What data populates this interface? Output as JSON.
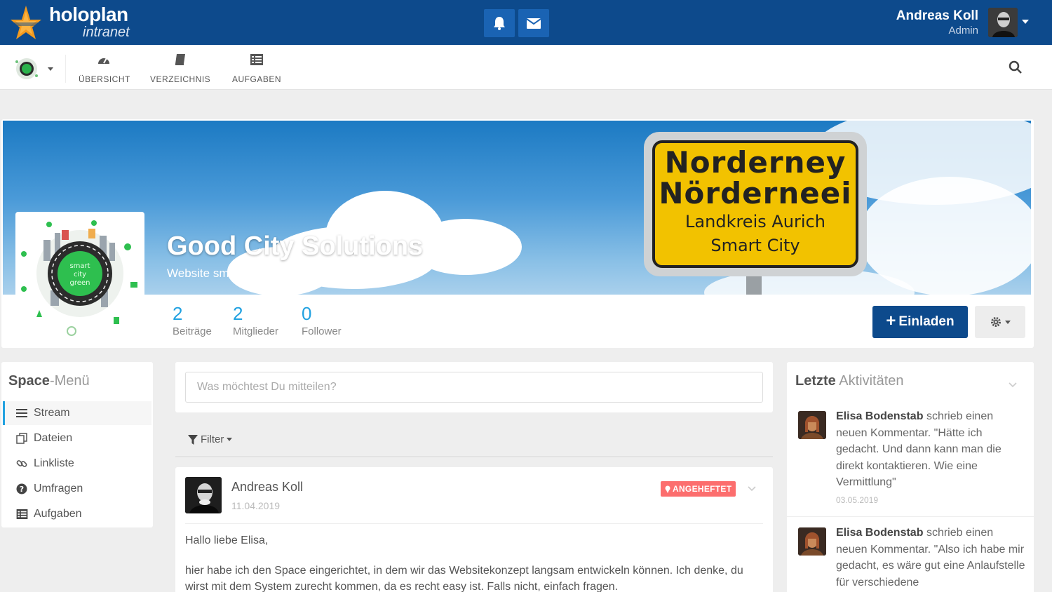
{
  "brand": {
    "name": "holoplan",
    "sub": "intranet"
  },
  "user": {
    "name": "Andreas Koll",
    "role": "Admin"
  },
  "nav": [
    {
      "label": "ÜBERSICHT",
      "icon": "dashboard-icon"
    },
    {
      "label": "VERZEICHNIS",
      "icon": "book-icon"
    },
    {
      "label": "AUFGABEN",
      "icon": "tasks-icon"
    }
  ],
  "space": {
    "title": "Good City Solutions",
    "description": "Website smartcity.green",
    "sign": {
      "line1": "Norderney",
      "line2": "Nörderneei",
      "line3": "Landkreis Aurich",
      "line4": "Smart City"
    },
    "logo_text": {
      "l1": "smart",
      "l2": "city",
      "l3": "green"
    }
  },
  "stats": [
    {
      "value": "2",
      "label": "Beiträge"
    },
    {
      "value": "2",
      "label": "Mitglieder"
    },
    {
      "value": "0",
      "label": "Follower"
    }
  ],
  "invite_label": "Einladen",
  "space_menu": {
    "title_bold": "Space",
    "title_rest": "-Menü",
    "items": [
      {
        "label": "Stream",
        "icon": "bars-icon",
        "active": true
      },
      {
        "label": "Dateien",
        "icon": "files-icon",
        "active": false
      },
      {
        "label": "Linkliste",
        "icon": "link-icon",
        "active": false
      },
      {
        "label": "Umfragen",
        "icon": "question-icon",
        "active": false
      },
      {
        "label": "Aufgaben",
        "icon": "tasks-icon",
        "active": false
      }
    ]
  },
  "post": {
    "placeholder": "Was möchtest Du mitteilen?"
  },
  "filter_label": "Filter",
  "entry": {
    "author": "Andreas Koll",
    "date": "11.04.2019",
    "pinned_label": "ANGEHEFTET",
    "greeting": "Hallo liebe Elisa,",
    "body": "hier habe ich den Space eingerichtet, in dem wir das Websitekonzept langsam entwickeln können. Ich denke, du wirst mit dem System zurecht kommen, da es recht easy ist. Falls nicht, einfach fragen."
  },
  "activities": {
    "title_bold": "Letzte",
    "title_rest": "Aktivitäten",
    "items": [
      {
        "user": "Elisa Bodenstab",
        "text": "schrieb einen neuen Kommentar. \"Hätte ich gedacht. Und dann kann man die direkt kontaktieren. Wie eine Vermittlung\"",
        "date": "03.05.2019"
      },
      {
        "user": "Elisa Bodenstab",
        "text": "schrieb einen neuen Kommentar. \"Also ich habe mir gedacht, es wäre gut eine Anlaufstelle für verschiedene",
        "date": ""
      }
    ]
  },
  "colors": {
    "primary": "#0d4a8c",
    "accent": "#21a1e0",
    "pinned": "#fc6e6e",
    "sign": "#f2c200"
  }
}
